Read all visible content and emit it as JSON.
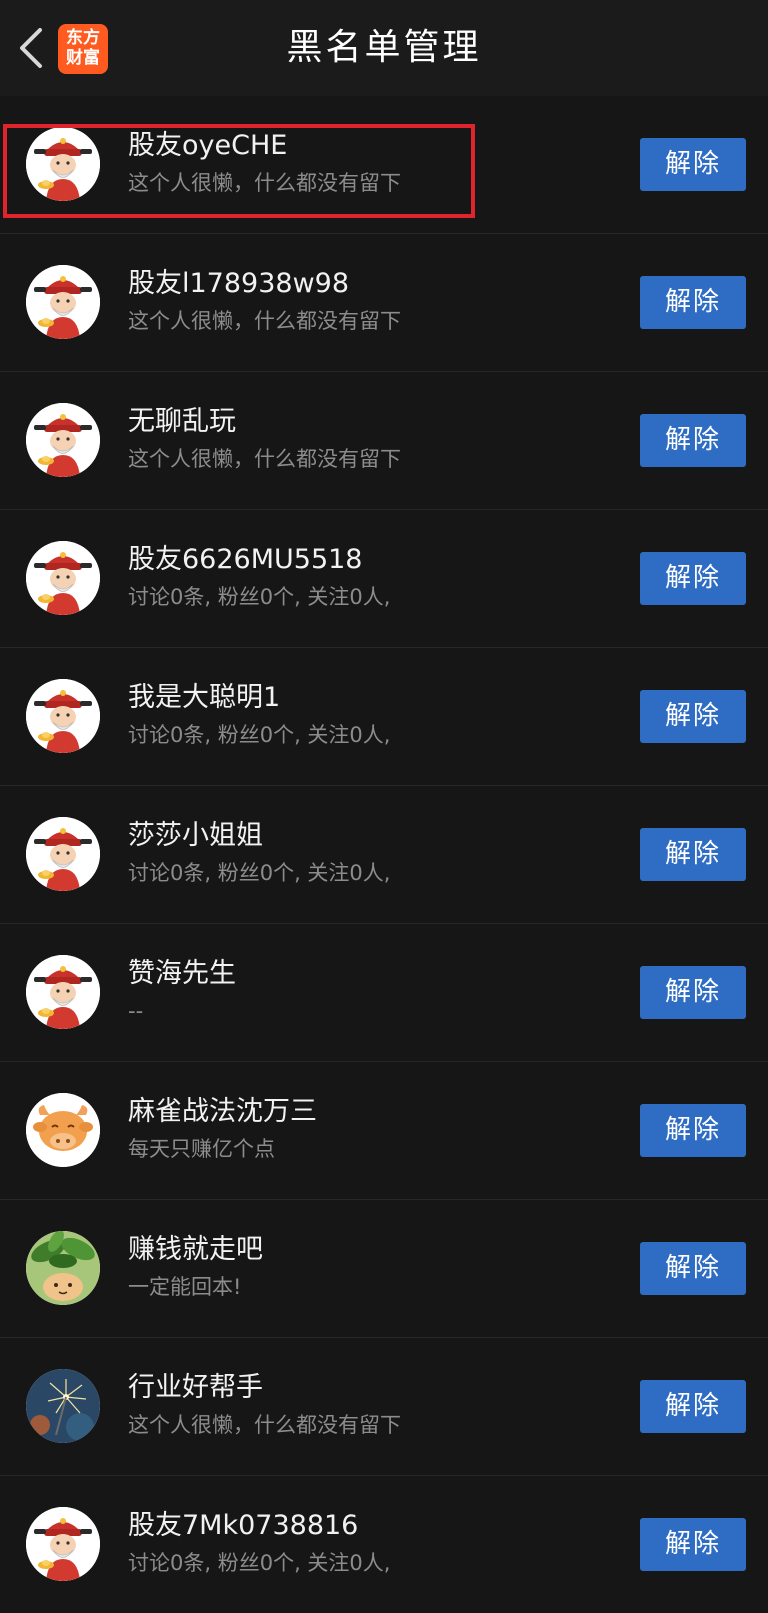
{
  "header": {
    "title": "黑名单管理",
    "logo_line1": "东方",
    "logo_line2": "财富",
    "back_icon": "chevron-left-icon"
  },
  "button_label": "解除",
  "colors": {
    "background": "#161616",
    "button": "#2f6dc4",
    "logo": "#ff5a1f",
    "highlight": "#e0242b"
  },
  "rows": [
    {
      "name": "股友oyeCHE",
      "desc": "这个人很懒，什么都没有留下",
      "avatar": "fortune-god-avatar"
    },
    {
      "name": "股友l178938w98",
      "desc": "这个人很懒，什么都没有留下",
      "avatar": "fortune-god-avatar"
    },
    {
      "name": "无聊乱玩",
      "desc": "这个人很懒，什么都没有留下",
      "avatar": "fortune-god-avatar"
    },
    {
      "name": "股友6626MU5518",
      "desc": "讨论0条, 粉丝0个, 关注0人,",
      "avatar": "fortune-god-avatar"
    },
    {
      "name": "我是大聪明1",
      "desc": "讨论0条, 粉丝0个, 关注0人,",
      "avatar": "fortune-god-avatar"
    },
    {
      "name": "莎莎小姐姐",
      "desc": "讨论0条, 粉丝0个, 关注0人,",
      "avatar": "fortune-god-avatar"
    },
    {
      "name": "赞海先生",
      "desc": "--",
      "avatar": "fortune-god-avatar"
    },
    {
      "name": "麻雀战法沈万三",
      "desc": "每天只赚亿个点",
      "avatar": "bull-avatar"
    },
    {
      "name": "赚钱就走吧",
      "desc": "一定能回本!",
      "avatar": "plant-avatar"
    },
    {
      "name": "行业好帮手",
      "desc": "这个人很懒，什么都没有留下",
      "avatar": "sparkler-avatar"
    },
    {
      "name": "股友7Mk0738816",
      "desc": "讨论0条, 粉丝0个, 关注0人,",
      "avatar": "fortune-god-avatar"
    }
  ]
}
